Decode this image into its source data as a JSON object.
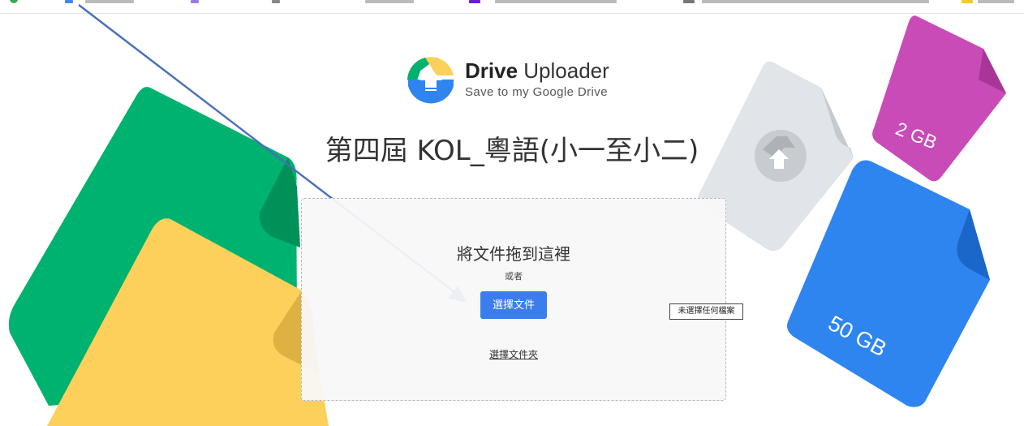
{
  "app": {
    "name_bold": "Drive",
    "name_light": "Uploader",
    "tagline": "Save to my Google Drive"
  },
  "page": {
    "title": "第四屆 KOL_粵語(小一至小二)"
  },
  "dropzone": {
    "heading": "將文件拖到這裡",
    "or_text": "或者",
    "choose_file_label": "選擇文件",
    "no_file_status": "未選擇任何檔案",
    "choose_folder_label": "選擇文件夾"
  },
  "decorations": {
    "pink_file_size": "2 GB",
    "blue_file_size": "50 GB"
  },
  "colors": {
    "green": "#00b26f",
    "yellow": "#fcd05a",
    "grey": "#e1e4e8",
    "pink": "#c94bb8",
    "blue": "#2f85ef",
    "button": "#3b7ded",
    "arrow": "#4a6fb8"
  }
}
